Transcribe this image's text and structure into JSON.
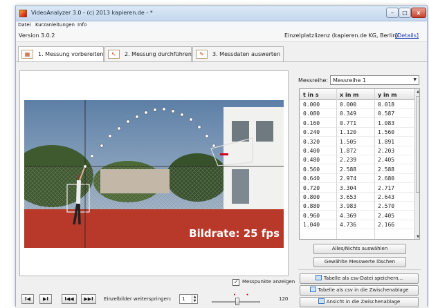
{
  "window": {
    "title": "VideoAnalyzer 3.0 - (c) 2013 kapieren.de - *",
    "buttons": {
      "minimize": "–",
      "maximize": "□",
      "close": "x"
    }
  },
  "menu": [
    "Datei",
    "Kurzanleitungen",
    "Info"
  ],
  "info": {
    "version": "Version 3.0.2",
    "license": "Einzelplatzlizenz (kapieren.de KG, Berlin)",
    "details_link": "[Details]"
  },
  "tabs": [
    {
      "label": "1. Messung vorbereiten",
      "icon": "video-icon"
    },
    {
      "label": "2. Messung durchführen",
      "icon": "cursor-icon"
    },
    {
      "label": "3. Messdaten auswerten",
      "icon": "chart-pencil-icon"
    }
  ],
  "video": {
    "overlay_text": "Bildrate: 25 fps"
  },
  "overlay_checkbox": {
    "label": "Messpunkte anzeigen",
    "checked": true
  },
  "controls": {
    "first": "I◀",
    "prev": "▶I",
    "back": "I◀◀",
    "forward": "▶▶I",
    "skip_label": "Einzelbilder weiterspringen:",
    "skip_value": "1",
    "slider_markers": "• •",
    "frame_number": "120"
  },
  "series": {
    "label": "Messreihe:",
    "value": "Messreihe 1"
  },
  "table": {
    "columns": [
      "t in s",
      "x in m",
      "y in m"
    ],
    "rows": [
      [
        "0.000",
        "0.000",
        "0.018"
      ],
      [
        "0.080",
        "0.349",
        "0.587"
      ],
      [
        "0.160",
        "0.771",
        "1.083"
      ],
      [
        "0.240",
        "1.120",
        "1.560"
      ],
      [
        "0.320",
        "1.505",
        "1.891"
      ],
      [
        "0.400",
        "1.872",
        "2.203"
      ],
      [
        "0.480",
        "2.239",
        "2.405"
      ],
      [
        "0.560",
        "2.588",
        "2.588"
      ],
      [
        "0.640",
        "2.974",
        "2.680"
      ],
      [
        "0.720",
        "3.304",
        "2.717"
      ],
      [
        "0.800",
        "3.653",
        "2.643"
      ],
      [
        "0.880",
        "3.983",
        "2.570"
      ],
      [
        "0.960",
        "4.369",
        "2.405"
      ],
      [
        "1.040",
        "4.736",
        "2.166"
      ]
    ]
  },
  "actions": {
    "select_all": "Alles/Nichts auswählen",
    "delete_selected": "Gewählte Messwerte löschen",
    "save_csv": "Tabelle als csv-Datei speichern...",
    "copy_csv": "Tabelle als csv in die Zwischenablage",
    "copy_view": "Ansicht in die Zwischenablage"
  },
  "colors": {
    "accent": "#1a3fb8",
    "court": "#b8392a",
    "ball": "#d0021b"
  }
}
